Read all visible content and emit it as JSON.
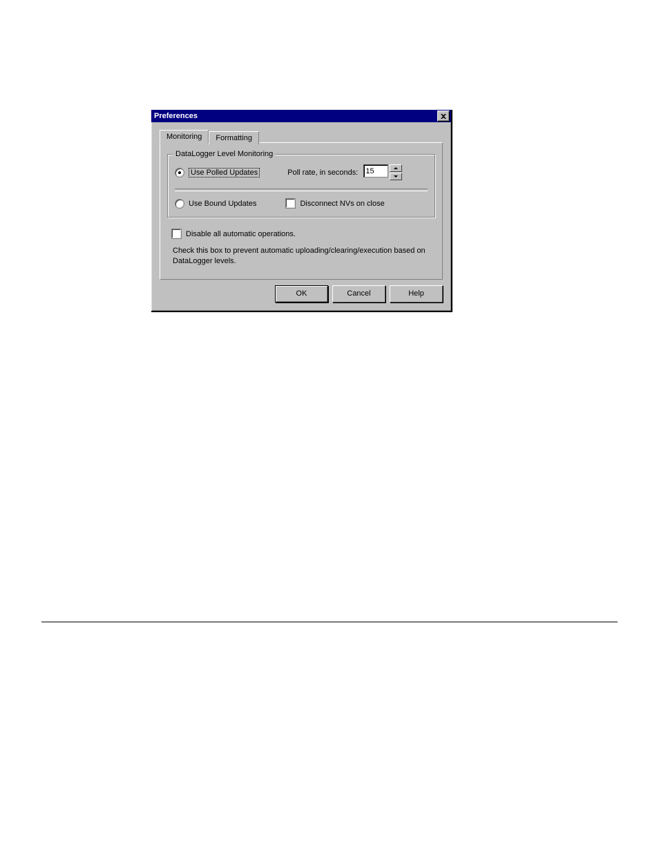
{
  "dialog": {
    "title": "Preferences",
    "tabs": {
      "monitoring": "Monitoring",
      "formatting": "Formatting"
    },
    "group": {
      "title": "DataLogger Level Monitoring",
      "polled": {
        "label": "Use Polled Updates",
        "selected": true
      },
      "pollrate": {
        "label": "Poll rate, in seconds:",
        "value": "15"
      },
      "bound": {
        "label": "Use Bound Updates",
        "selected": false
      },
      "disconnect": {
        "label": "Disconnect NVs on close",
        "checked": false
      }
    },
    "disable": {
      "label": "Disable all automatic operations.",
      "help": "Check this box to prevent automatic uploading/clearing/execution based on DataLogger levels."
    },
    "buttons": {
      "ok": "OK",
      "cancel": "Cancel",
      "help": "Help"
    }
  }
}
